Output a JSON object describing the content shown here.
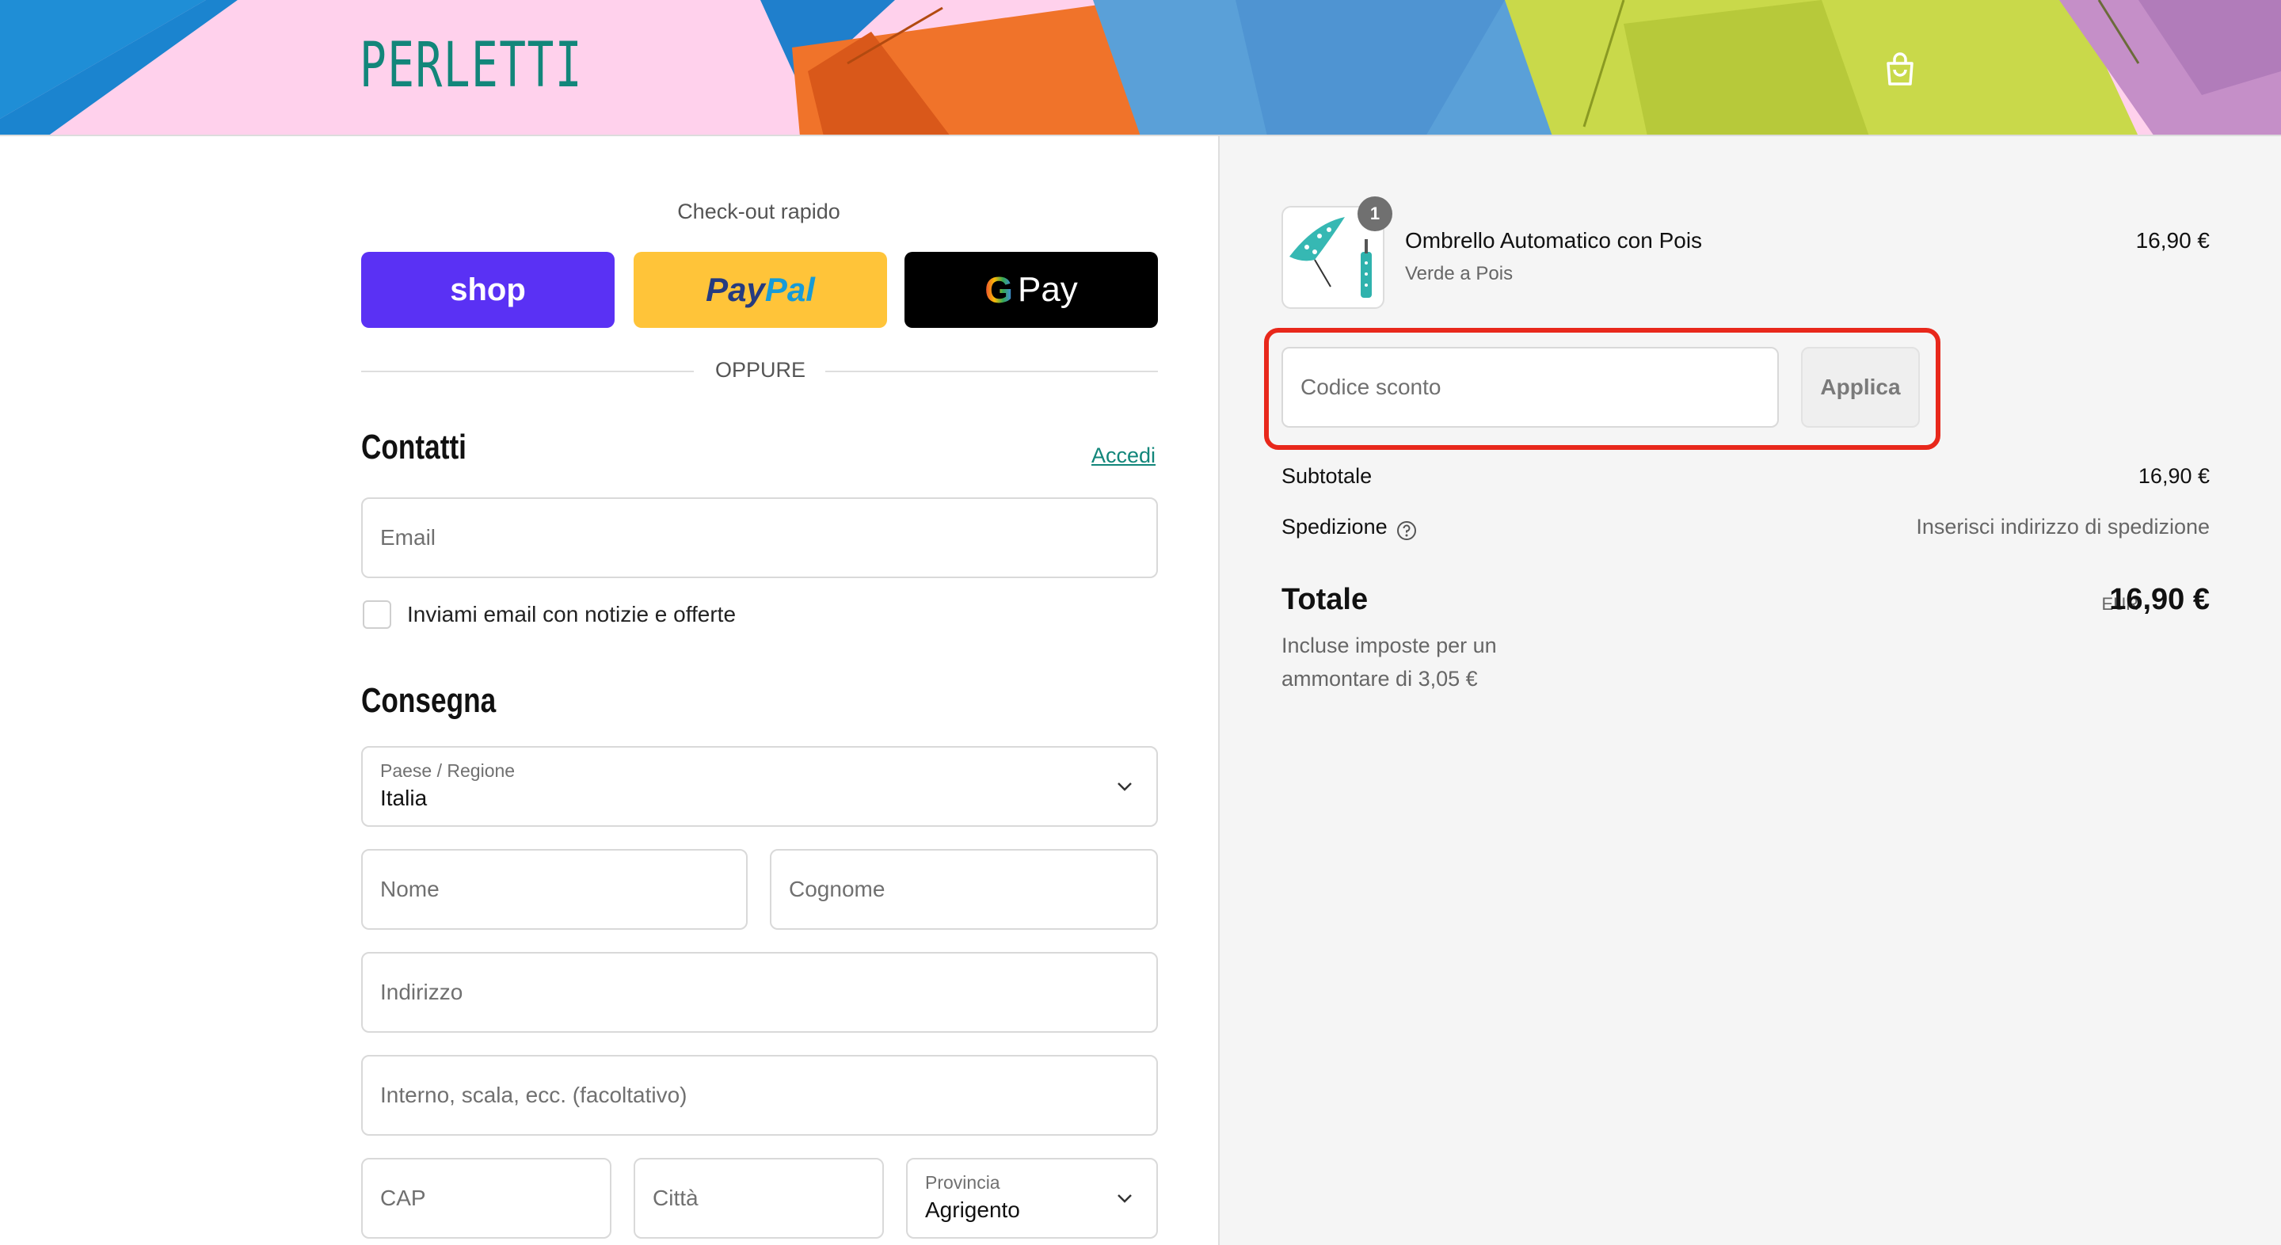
{
  "brand": {
    "logo": "PERLETTI",
    "accent": "#12867a"
  },
  "fast_checkout": {
    "title": "Check-out rapido",
    "shop_label": "shop",
    "paypal_part1": "Pay",
    "paypal_part2": "Pal",
    "gpay_g": "G",
    "gpay_label": "Pay",
    "divider": "OPPURE"
  },
  "contacts": {
    "title": "Contatti",
    "login_link": "Accedi",
    "email_placeholder": "Email",
    "newsletter_label": "Inviami email con notizie e offerte"
  },
  "delivery": {
    "title": "Consegna",
    "country_label": "Paese / Regione",
    "country_value": "Italia",
    "first_name_placeholder": "Nome",
    "last_name_placeholder": "Cognome",
    "address_placeholder": "Indirizzo",
    "address2_placeholder": "Interno, scala, ecc. (facoltativo)",
    "zip_placeholder": "CAP",
    "city_placeholder": "Città",
    "province_label": "Provincia",
    "province_value": "Agrigento"
  },
  "order": {
    "item": {
      "quantity": "1",
      "name": "Ombrello Automatico con Pois",
      "variant": "Verde a Pois",
      "price": "16,90 €"
    },
    "discount_placeholder": "Codice sconto",
    "apply_label": "Applica",
    "subtotal_label": "Subtotale",
    "subtotal_value": "16,90 €",
    "shipping_label": "Spedizione",
    "shipping_value": "Inserisci indirizzo di spedizione",
    "total_label": "Totale",
    "currency": "EUR",
    "total_value": "16,90 €",
    "tax_note": "Incluse imposte per un ammontare di 3,05 €"
  },
  "colors": {
    "shop": "#5a31f4",
    "paypal": "#ffc439",
    "gpay": "#000000",
    "highlight": "#e8281b"
  }
}
